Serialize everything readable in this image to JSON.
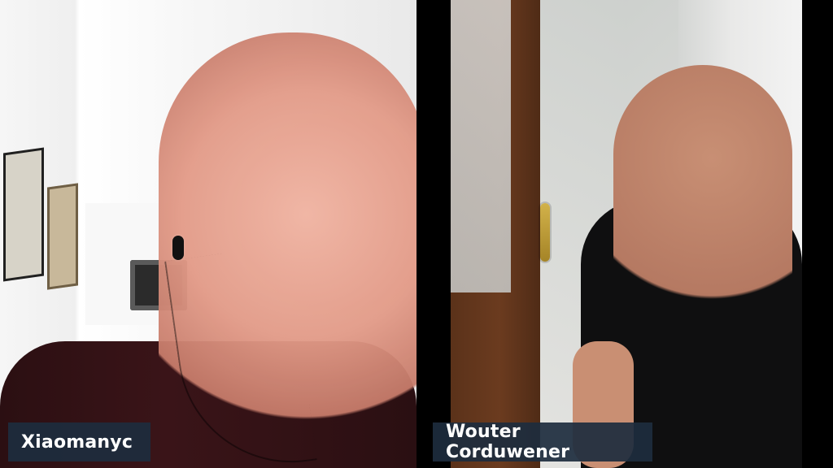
{
  "participants": [
    {
      "name": "Xiaomanyc"
    },
    {
      "name": "Wouter Corduwener"
    }
  ],
  "theme": {
    "name_label_bg": "#1D2C3E",
    "name_label_text": "#FFFFFF"
  }
}
